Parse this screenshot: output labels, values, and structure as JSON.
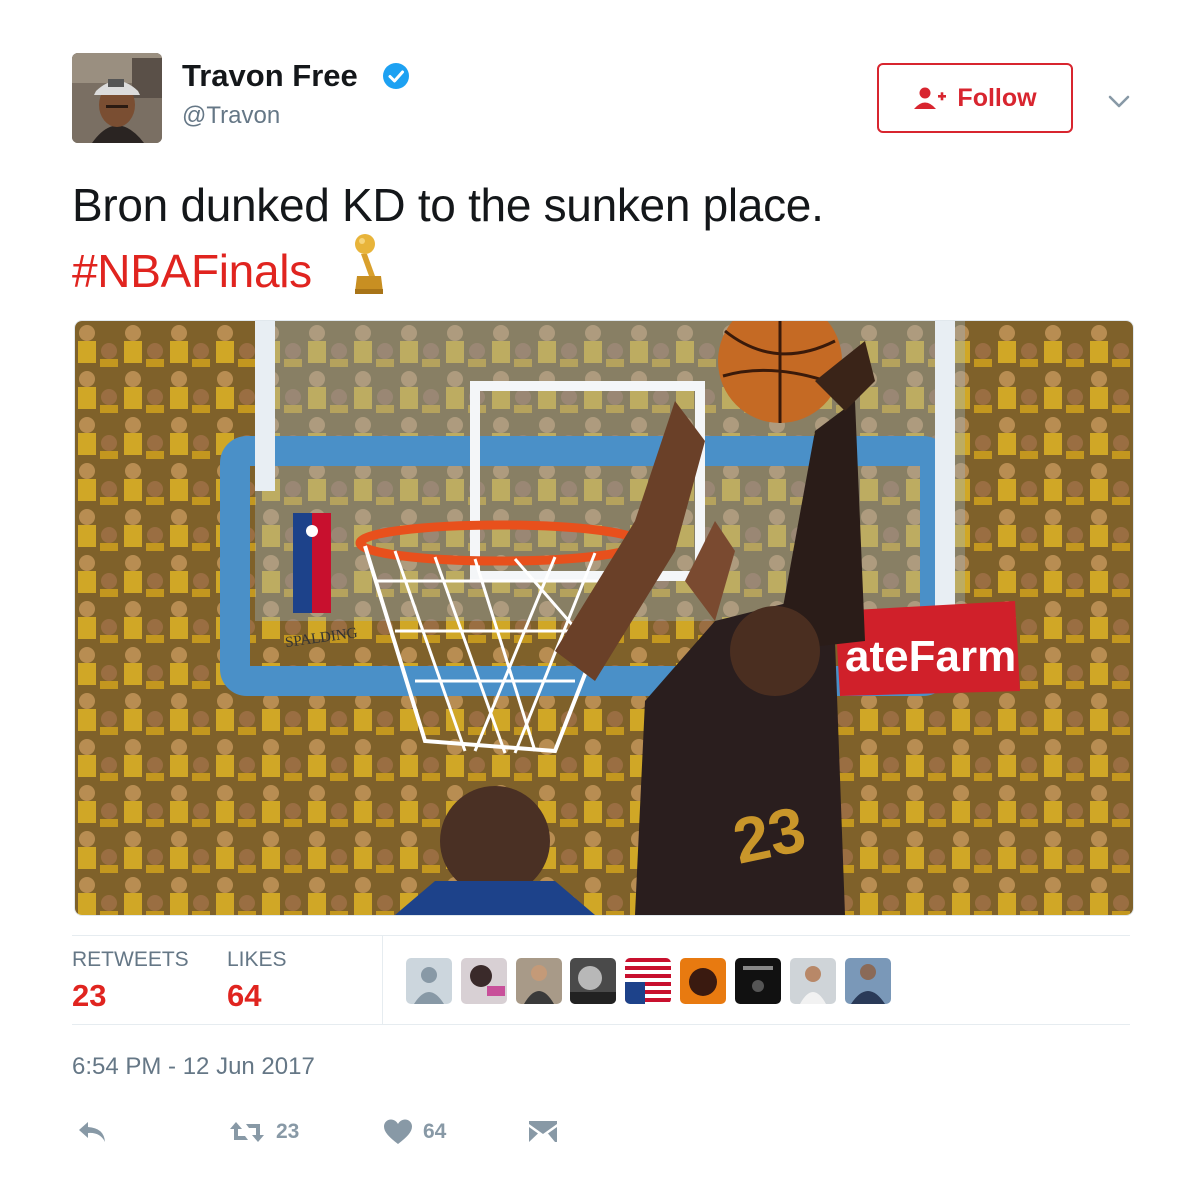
{
  "author": {
    "display_name": "Travon Free",
    "handle": "@Travon",
    "verified": true
  },
  "follow_button": {
    "label": "Follow",
    "icon": "add-user-icon"
  },
  "tweet": {
    "text": "Bron dunked KD to the sunken place.",
    "hashtag": "#NBAFinals",
    "hashtag_emoji": "trophy-icon"
  },
  "stats": {
    "retweets_label": "RETWEETS",
    "retweets_value": "23",
    "likes_label": "LIKES",
    "likes_value": "64"
  },
  "timestamp": "6:54 PM - 12 Jun 2017",
  "actions": {
    "reply_icon": "reply-icon",
    "retweet_count": "23",
    "like_count": "64",
    "message_icon": "envelope-icon"
  },
  "colors": {
    "accent_red": "#d8252f",
    "hashtag_red": "#e0241f",
    "muted_gray": "#657786",
    "verified_blue": "#1da1f2"
  }
}
